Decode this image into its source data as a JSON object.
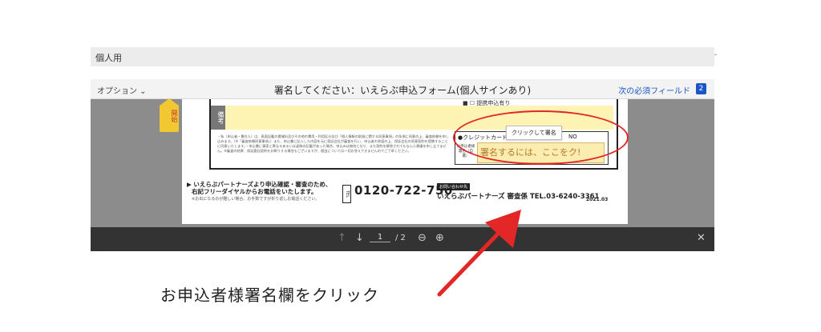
{
  "top_bar": {
    "label": "個人用"
  },
  "header": {
    "options_label": "オプション ⌄",
    "title": "署名してください：いえらぶ申込フォーム(個人サインあり)",
    "next_field_label": "次の必須フィールド",
    "next_field_count": "2"
  },
  "document": {
    "start_tag": "開始",
    "remarks_label": "備考",
    "top_checkbox": "■ ☐ 提携申込有り",
    "notes": "・私（申込者・責任人）は、表面記載の賃貸料及びその他の費用・利用区分及び「個人情報の取扱に関する同意事項」の条項に同意の上、審査依頼を申し込みます。（※「審査依頼同意事項」）また、申込書に記入した内容を元に保証会社が審査を行い、申込者の承諾の上、保証会社の同意契約を提携することに同意いたします。・申込書に事実と異なるあるいは虚偽の記載があった場合、申込みは無効となり、また契約を解除されてもなんら異議を申し立てません。※審査の結果、保証委託契約をお断りする場合もございますが、理由については一切お答えできませんのでご了承ください。",
    "credit_label": "●クレジットカードを",
    "no_label": "NO",
    "signature_label": "お申込者様署名（自署）",
    "signature_prompt": "署名するには、ここをク!",
    "tooltip": "クリックして署名",
    "contact_line1": "▶ いえらぶパートナーズより申込確認・審査のため、",
    "contact_line2": "右記フリーダイヤルからお電話をいたします。",
    "contact_note": "※お出になるのが難しい場合、お手数ですが折り返しお電話ください。",
    "tel_badge": "TEL",
    "tel_number": "0120-722-750",
    "inquiry_label": "お問い合わせ先",
    "company_line": "いえらぶパートナーズ 審査係 TEL.03-6240-3361",
    "year": "2021.03"
  },
  "toolbar": {
    "prev_icon": "↑",
    "next_icon": "↓",
    "page_current": "1",
    "page_total": "/ 2",
    "zoom_out_icon": "⊖",
    "zoom_in_icon": "⊕",
    "close_icon": "✕"
  },
  "annotation": {
    "caption": "お申込者様署名欄をクリック",
    "color": "#e32626"
  },
  "colors": {
    "toolbar_bg": "#333333",
    "frame_bg": "#8c8c8c",
    "signature_field": "#fbedb0",
    "link_blue": "#1a56c8"
  }
}
